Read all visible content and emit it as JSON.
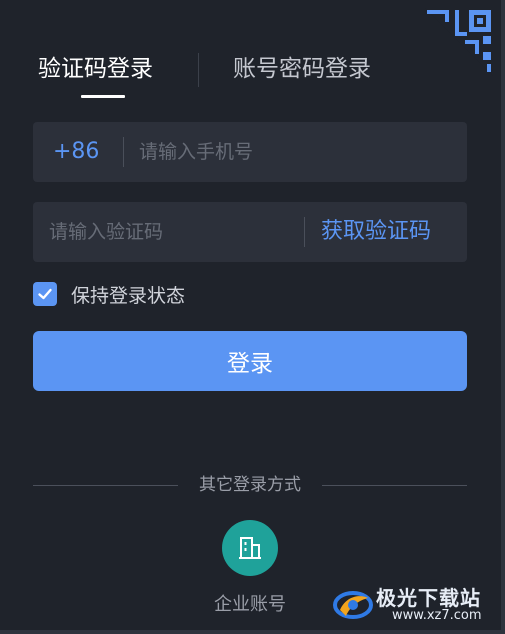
{
  "tabs": [
    {
      "label": "验证码登录",
      "active": true
    },
    {
      "label": "账号密码登录",
      "active": false
    }
  ],
  "phone": {
    "country_code": "+86",
    "value": "",
    "placeholder": "请输入手机号"
  },
  "code": {
    "value": "",
    "placeholder": "请输入验证码",
    "get_code_label": "获取验证码"
  },
  "remember": {
    "label": "保持登录状态",
    "checked": true
  },
  "login_button": {
    "label": "登录"
  },
  "other_login": {
    "label": "其它登录方式",
    "enterprise_label": "企业账号",
    "enterprise_icon": "building-icon"
  },
  "watermark": {
    "name": "极光下载站",
    "url": "www.xz7.com"
  },
  "colors": {
    "background": "#1f232b",
    "field": "#2c303a",
    "accent": "#5b95f3",
    "enterprise": "#1fa29a"
  }
}
